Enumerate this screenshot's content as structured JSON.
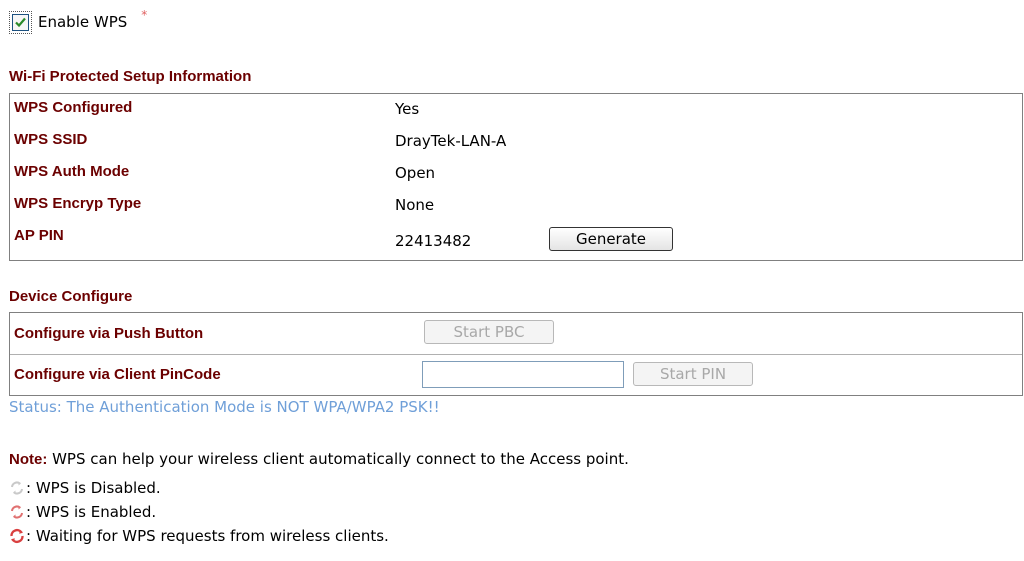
{
  "enable_wps": {
    "label": "Enable WPS",
    "checked": true,
    "required_mark": "*"
  },
  "wps_info": {
    "title": "Wi-Fi Protected Setup Information",
    "rows": [
      {
        "label": "WPS Configured",
        "value": "Yes"
      },
      {
        "label": "WPS SSID",
        "value": "DrayTek-LAN-A"
      },
      {
        "label": "WPS Auth Mode",
        "value": "Open"
      },
      {
        "label": "WPS Encryp Type",
        "value": "None"
      },
      {
        "label": "AP PIN",
        "value": "22413482"
      }
    ],
    "generate_button": "Generate"
  },
  "device_configure": {
    "title": "Device Configure",
    "push_button_label": "Configure via Push Button",
    "start_pbc_button": "Start PBC",
    "client_pincode_label": "Configure via Client PinCode",
    "pincode_input_value": "",
    "start_pin_button": "Start PIN"
  },
  "status_text": "Status: The Authentication Mode is NOT WPA/WPA2 PSK!!",
  "note": {
    "label": "Note:",
    "text": " WPS can help your wireless client automatically connect to the Access point."
  },
  "legend": [
    {
      "icon": "wps-disabled-icon",
      "text": ": WPS is Disabled."
    },
    {
      "icon": "wps-enabled-icon",
      "text": ": WPS is Enabled."
    },
    {
      "icon": "wps-waiting-icon",
      "text": ": Waiting for WPS requests from wireless clients."
    }
  ],
  "colors": {
    "label_red": "#6b0000",
    "status_blue": "#6f9fd8",
    "checkbox_check": "#2a8a2a"
  }
}
